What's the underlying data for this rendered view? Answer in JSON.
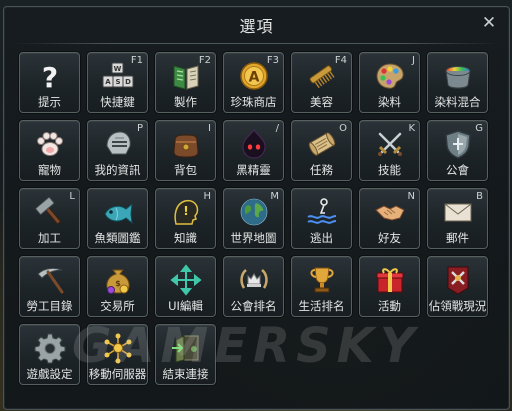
{
  "window": {
    "title": "選項",
    "close_glyph": "✕"
  },
  "watermark": "GAMERSKY",
  "tiles": [
    {
      "label": "提示",
      "hotkey": "",
      "icon": "help-icon"
    },
    {
      "label": "快捷鍵",
      "hotkey": "F1",
      "icon": "keyboard-icon",
      "keys": [
        "W",
        "A",
        "S",
        "D"
      ]
    },
    {
      "label": "製作",
      "hotkey": "F2",
      "icon": "crafting-book-icon"
    },
    {
      "label": "珍珠商店",
      "hotkey": "F3",
      "icon": "pearl-shop-icon",
      "shop_glyph": "A"
    },
    {
      "label": "美容",
      "hotkey": "F4",
      "icon": "comb-icon"
    },
    {
      "label": "染料",
      "hotkey": "J",
      "icon": "palette-icon"
    },
    {
      "label": "染料混合",
      "hotkey": "",
      "icon": "dye-pot-icon"
    },
    {
      "label": "寵物",
      "hotkey": "",
      "icon": "paw-icon"
    },
    {
      "label": "我的資訊",
      "hotkey": "P",
      "icon": "helmet-icon"
    },
    {
      "label": "背包",
      "hotkey": "I",
      "icon": "bag-icon"
    },
    {
      "label": "黑精靈",
      "hotkey": "/",
      "icon": "black-spirit-icon"
    },
    {
      "label": "任務",
      "hotkey": "O",
      "icon": "scroll-icon"
    },
    {
      "label": "技能",
      "hotkey": "K",
      "icon": "crossed-swords-icon"
    },
    {
      "label": "公會",
      "hotkey": "G",
      "icon": "guild-shield-icon"
    },
    {
      "label": "加工",
      "hotkey": "L",
      "icon": "hammer-icon"
    },
    {
      "label": "魚類圖鑑",
      "hotkey": "",
      "icon": "fish-icon"
    },
    {
      "label": "知識",
      "hotkey": "H",
      "icon": "knowledge-head-icon"
    },
    {
      "label": "世界地圖",
      "hotkey": "M",
      "icon": "globe-icon"
    },
    {
      "label": "逃出",
      "hotkey": "",
      "icon": "escape-wave-icon"
    },
    {
      "label": "好友",
      "hotkey": "N",
      "icon": "handshake-icon"
    },
    {
      "label": "郵件",
      "hotkey": "B",
      "icon": "mail-icon"
    },
    {
      "label": "勞工目錄",
      "hotkey": "",
      "icon": "pickaxe-icon"
    },
    {
      "label": "交易所",
      "hotkey": "",
      "icon": "money-bag-icon"
    },
    {
      "label": "UI編輯",
      "hotkey": "",
      "icon": "move-arrows-icon"
    },
    {
      "label": "公會排名",
      "hotkey": "",
      "icon": "laurel-crown-icon"
    },
    {
      "label": "生活排名",
      "hotkey": "",
      "icon": "trophy-icon"
    },
    {
      "label": "活動",
      "hotkey": "",
      "icon": "gift-box-icon"
    },
    {
      "label": "佔領戰現況",
      "hotkey": "",
      "icon": "siege-banner-icon"
    },
    {
      "label": "遊戲設定",
      "hotkey": "",
      "icon": "gear-icon"
    },
    {
      "label": "移動伺服器",
      "hotkey": "",
      "icon": "server-nodes-icon"
    },
    {
      "label": "結束連接",
      "hotkey": "",
      "icon": "exit-door-icon"
    }
  ],
  "colors": {
    "panel_bg": "#161c1f",
    "tile_border": "#55605f",
    "text": "#e4e6e5",
    "gold": "#e0b44a"
  }
}
